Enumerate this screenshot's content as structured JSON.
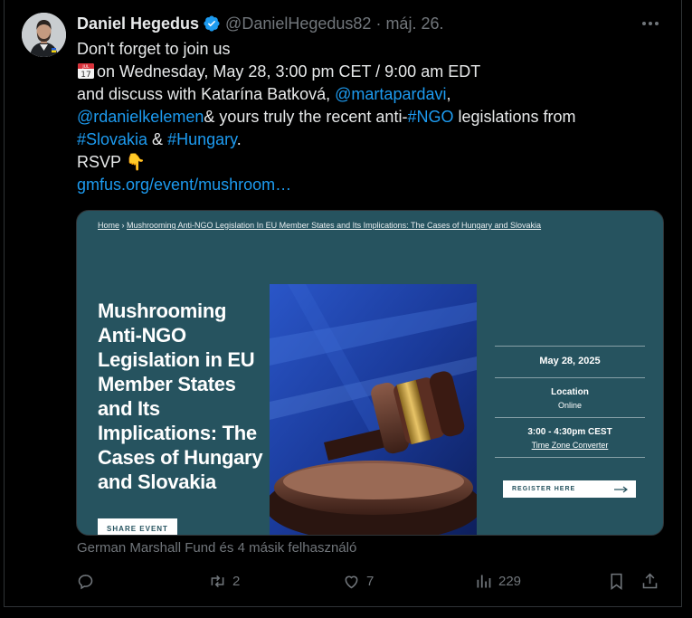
{
  "author": {
    "name": "Daniel Hegedus",
    "handle": "@DanielHegedus82",
    "separator": "·",
    "date": "máj. 26."
  },
  "tweet": {
    "line1": "Don't forget to join us",
    "line2": "on Wednesday, May 28, 3:00 pm CET / 9:00 am EDT",
    "line3_a": "and discuss with Katarína Batková, ",
    "mention1": "@martapardavi",
    "line3_b": ",",
    "mention2": "@rdanielkelemen",
    "line4_a": "& yours truly the recent anti-",
    "hashtag1": "#NGO",
    "line4_b": " legislations from",
    "hashtag2": "#Slovakia",
    "line5_a": " & ",
    "hashtag3": "#Hungary",
    "line5_b": ".",
    "rsvp": "RSVP 👇",
    "url": "gmfus.org/event/mushroom…",
    "calendar_icon": "calendar-icon",
    "calendar_day": "17",
    "calendar_month": "JUL"
  },
  "card": {
    "breadcrumb_home": "Home",
    "breadcrumb_sep": " › ",
    "breadcrumb_page": "Mushrooming Anti-NGO Legislation In EU Member States and Its Implications: The Cases of Hungary and Slovakia",
    "title": "Mushrooming Anti-NGO Legislation in EU Member States and Its Implications: The Cases of Hungary and Slovakia",
    "share_label": "SHARE EVENT",
    "date": "May 28, 2025",
    "location_label": "Location",
    "location_value": "Online",
    "time": "3:00 - 4:30pm CEST",
    "tz_link": "Time Zone Converter",
    "register_label": "REGISTER HERE",
    "colors": {
      "panel": "#26535f"
    }
  },
  "social_context": "German Marshall Fund és 4 másik felhasználó",
  "actions": {
    "retweets": "2",
    "likes": "7",
    "views": "229"
  },
  "colors": {
    "link": "#1d9bf0",
    "muted": "#71767b",
    "text": "#e7e9ea",
    "background": "#000000"
  }
}
